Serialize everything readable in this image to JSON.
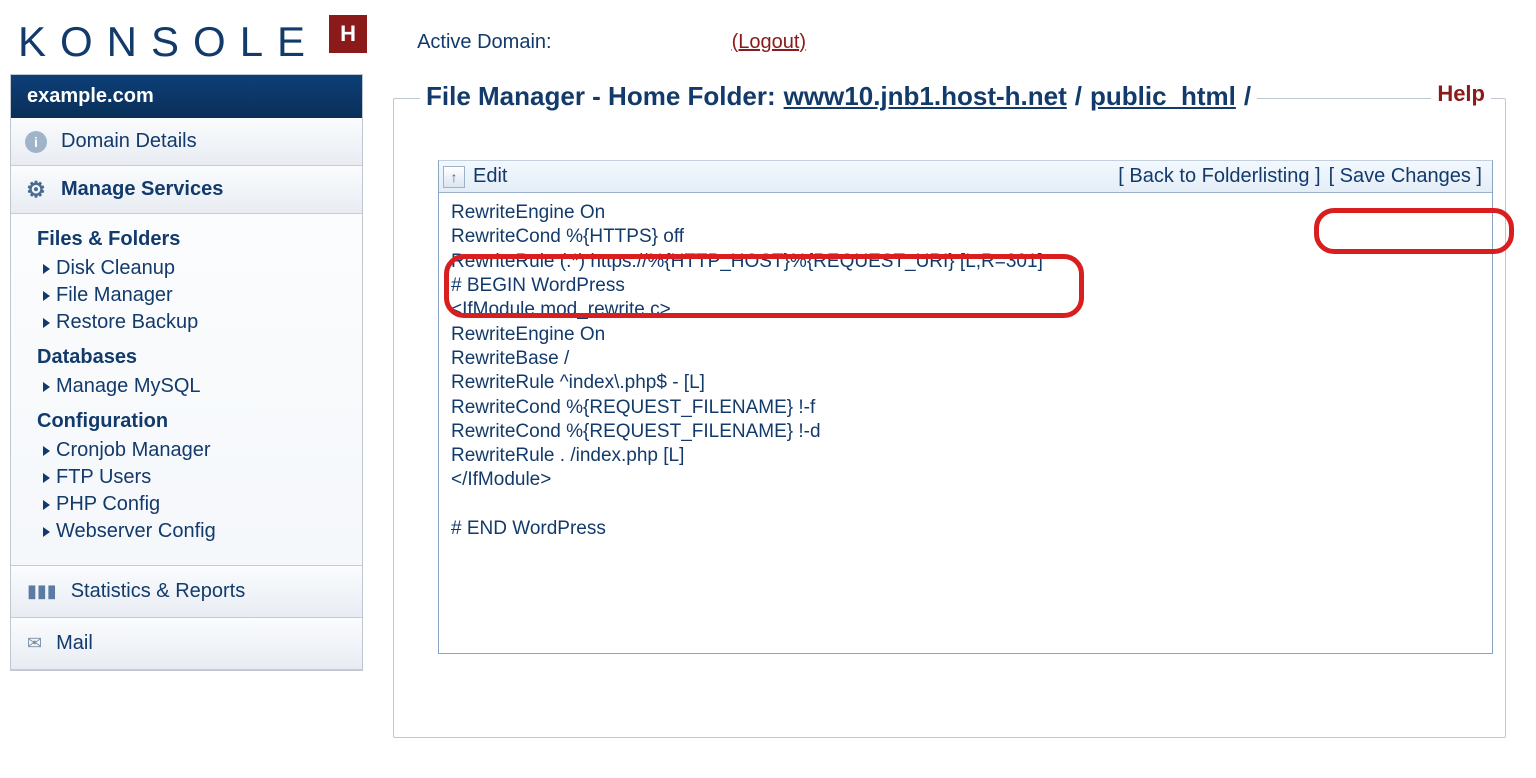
{
  "logo": {
    "text": "KONSOLE",
    "badge": "H"
  },
  "header": {
    "active_domain_label": "Active Domain:",
    "logout_label": "(Logout)"
  },
  "sidebar": {
    "domain": "example.com",
    "domain_details": "Domain Details",
    "manage_services": "Manage Services",
    "groups": [
      {
        "title": "Files & Folders",
        "items": [
          "Disk Cleanup",
          "File Manager",
          "Restore Backup"
        ]
      },
      {
        "title": "Databases",
        "items": [
          "Manage MySQL"
        ]
      },
      {
        "title": "Configuration",
        "items": [
          "Cronjob Manager",
          "FTP Users",
          "PHP Config",
          "Webserver Config"
        ]
      }
    ],
    "stats": "Statistics & Reports",
    "mail": "Mail"
  },
  "main": {
    "title_prefix": "File Manager - Home Folder: ",
    "path_host": "www10.jnb1.host-h.net",
    "path_folder": "public_html",
    "help": "Help",
    "toolbar": {
      "edit": "Edit",
      "back": "[ Back to Folderlisting ]",
      "save": "[ Save Changes ]"
    },
    "editor_content": "RewriteEngine On\nRewriteCond %{HTTPS} off\nRewriteRule (.*) https://%{HTTP_HOST}%{REQUEST_URI} [L,R=301]\n# BEGIN WordPress\n<IfModule mod_rewrite.c>\nRewriteEngine On\nRewriteBase /\nRewriteRule ^index\\.php$ - [L]\nRewriteCond %{REQUEST_FILENAME} !-f\nRewriteCond %{REQUEST_FILENAME} !-d\nRewriteRule . /index.php [L]\n</IfModule>\n\n# END WordPress"
  }
}
